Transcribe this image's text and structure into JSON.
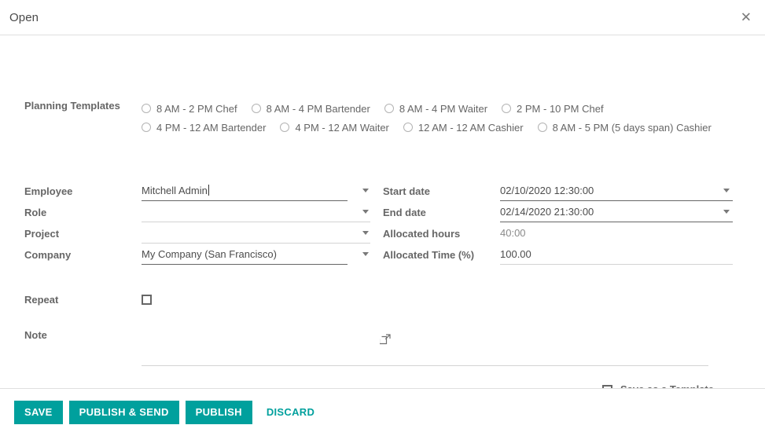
{
  "dialog": {
    "title": "Open",
    "close_icon": "close-icon"
  },
  "planning_templates": {
    "label": "Planning Templates",
    "options": [
      {
        "label": "8 AM - 2 PM Chef",
        "selected": false
      },
      {
        "label": "8 AM - 4 PM Bartender",
        "selected": false
      },
      {
        "label": "8 AM - 4 PM Waiter",
        "selected": false
      },
      {
        "label": "2 PM - 10 PM Chef",
        "selected": false
      },
      {
        "label": "4 PM - 12 AM Bartender",
        "selected": false
      },
      {
        "label": "4 PM - 12 AM Waiter",
        "selected": false
      },
      {
        "label": "12 AM - 12 AM Cashier",
        "selected": false
      },
      {
        "label": "8 AM - 5 PM (5 days span) Cashier",
        "selected": false
      }
    ]
  },
  "left_fields": {
    "employee": {
      "label": "Employee",
      "value": "Mitchell Admin",
      "placeholder": "",
      "focused": true,
      "has_external_link": true
    },
    "role": {
      "label": "Role",
      "value": "",
      "placeholder": ""
    },
    "project": {
      "label": "Project",
      "value": "",
      "placeholder": ""
    },
    "company": {
      "label": "Company",
      "value": "My Company (San Francisco)",
      "placeholder": "",
      "has_external_link": true
    }
  },
  "right_fields": {
    "start_date": {
      "label": "Start date",
      "value": "02/10/2020 12:30:00"
    },
    "end_date": {
      "label": "End date",
      "value": "02/14/2020 21:30:00"
    },
    "allocated_hours": {
      "label": "Allocated hours",
      "value": "40:00",
      "readonly": true
    },
    "allocated_time": {
      "label": "Allocated Time (%)",
      "value": "100.00"
    }
  },
  "repeat": {
    "label": "Repeat",
    "checked": false
  },
  "note": {
    "label": "Note",
    "value": "",
    "placeholder": ""
  },
  "save_as_template": {
    "label": "Save as a Template",
    "checked": false
  },
  "footer": {
    "save_label": "SAVE",
    "publish_send_label": "PUBLISH & SEND",
    "publish_label": "PUBLISH",
    "discard_label": "DISCARD"
  },
  "colors": {
    "primary": "#00a09d",
    "label_text": "#666666",
    "value_text": "#4c4c4c",
    "border": "#dfdfdf"
  }
}
